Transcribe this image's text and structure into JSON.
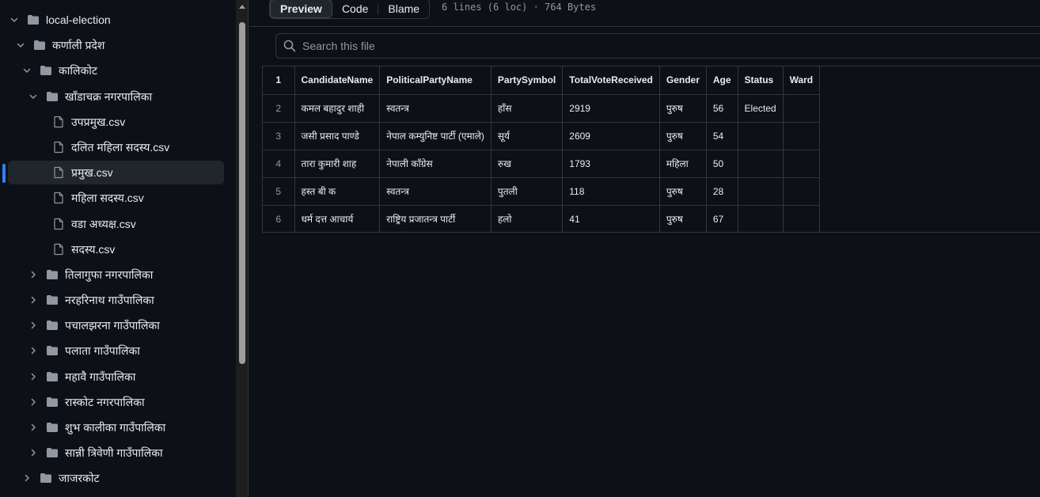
{
  "sidebar": {
    "tree": [
      {
        "label": "local-election",
        "type": "folder",
        "expanded": true,
        "selected": false
      },
      {
        "label": "कर्णाली प्रदेश",
        "type": "folder",
        "expanded": true,
        "selected": false
      },
      {
        "label": "कालिकोट",
        "type": "folder",
        "expanded": true,
        "selected": false
      },
      {
        "label": "खाँडाचक्र नगरपालिका",
        "type": "folder",
        "expanded": true,
        "selected": false
      },
      {
        "label": "उपप्रमुख.csv",
        "type": "file",
        "selected": false
      },
      {
        "label": "दलित महिला सदस्य.csv",
        "type": "file",
        "selected": false
      },
      {
        "label": "प्रमुख.csv",
        "type": "file",
        "selected": true
      },
      {
        "label": "महिला सदस्य.csv",
        "type": "file",
        "selected": false
      },
      {
        "label": "वडा अध्यक्ष.csv",
        "type": "file",
        "selected": false
      },
      {
        "label": "सदस्य.csv",
        "type": "file",
        "selected": false
      },
      {
        "label": "तिलागुफा नगरपालिका",
        "type": "folder",
        "expanded": false,
        "selected": false
      },
      {
        "label": "नरहरिनाथ गाउँपालिका",
        "type": "folder",
        "expanded": false,
        "selected": false
      },
      {
        "label": "पचालझरना गाउँपालिका",
        "type": "folder",
        "expanded": false,
        "selected": false
      },
      {
        "label": "पलाता गाउँपालिका",
        "type": "folder",
        "expanded": false,
        "selected": false
      },
      {
        "label": "महावै गाउँपालिका",
        "type": "folder",
        "expanded": false,
        "selected": false
      },
      {
        "label": "रास्कोट नगरपालिका",
        "type": "folder",
        "expanded": false,
        "selected": false
      },
      {
        "label": "शुभ कालीका गाउँपालिका",
        "type": "folder",
        "expanded": false,
        "selected": false
      },
      {
        "label": "सान्नी त्रिवेणी गाउँपालिका",
        "type": "folder",
        "expanded": false,
        "selected": false
      },
      {
        "label": "जाजरकोट",
        "type": "folder",
        "expanded": false,
        "selected": false
      }
    ]
  },
  "toolbar": {
    "tabs": [
      {
        "label": "Preview",
        "active": true
      },
      {
        "label": "Code",
        "active": false
      },
      {
        "label": "Blame",
        "active": false
      }
    ],
    "file_info": "6 lines (6 loc) · 764 Bytes"
  },
  "search": {
    "placeholder": "Search this file"
  },
  "table": {
    "headers": [
      "CandidateName",
      "PoliticalPartyName",
      "PartySymbol",
      "TotalVoteReceived",
      "Gender",
      "Age",
      "Status",
      "Ward"
    ],
    "line_numbers": [
      "1",
      "2",
      "3",
      "4",
      "5",
      "6"
    ],
    "rows": [
      [
        "कमल बहादुर शाही",
        "स्वतन्त्र",
        "हाँस",
        "2919",
        "पुरुष",
        "56",
        "Elected",
        ""
      ],
      [
        "जसी प्रसाद पाण्डे",
        "नेपाल कम्युनिष्ट पार्टी (एमाले)",
        "सूर्य",
        "2609",
        "पुरुष",
        "54",
        "",
        ""
      ],
      [
        "तारा कुमारी शाह",
        "नेपाली काँग्रेस",
        "रुख",
        "1793",
        "महिला",
        "50",
        "",
        ""
      ],
      [
        "हस्त बी क",
        "स्वतन्त्र",
        "पुतली",
        "118",
        "पुरुष",
        "28",
        "",
        ""
      ],
      [
        "धर्म दत्त आचार्य",
        "राष्ट्रिय प्रजातन्त्र पार्टी",
        "हलो",
        "41",
        "पुरुष",
        "67",
        "",
        ""
      ]
    ]
  },
  "colors": {
    "background": "#0d1117",
    "accent": "#2f81f7",
    "border": "#30363d",
    "muted": "#9198a1"
  }
}
